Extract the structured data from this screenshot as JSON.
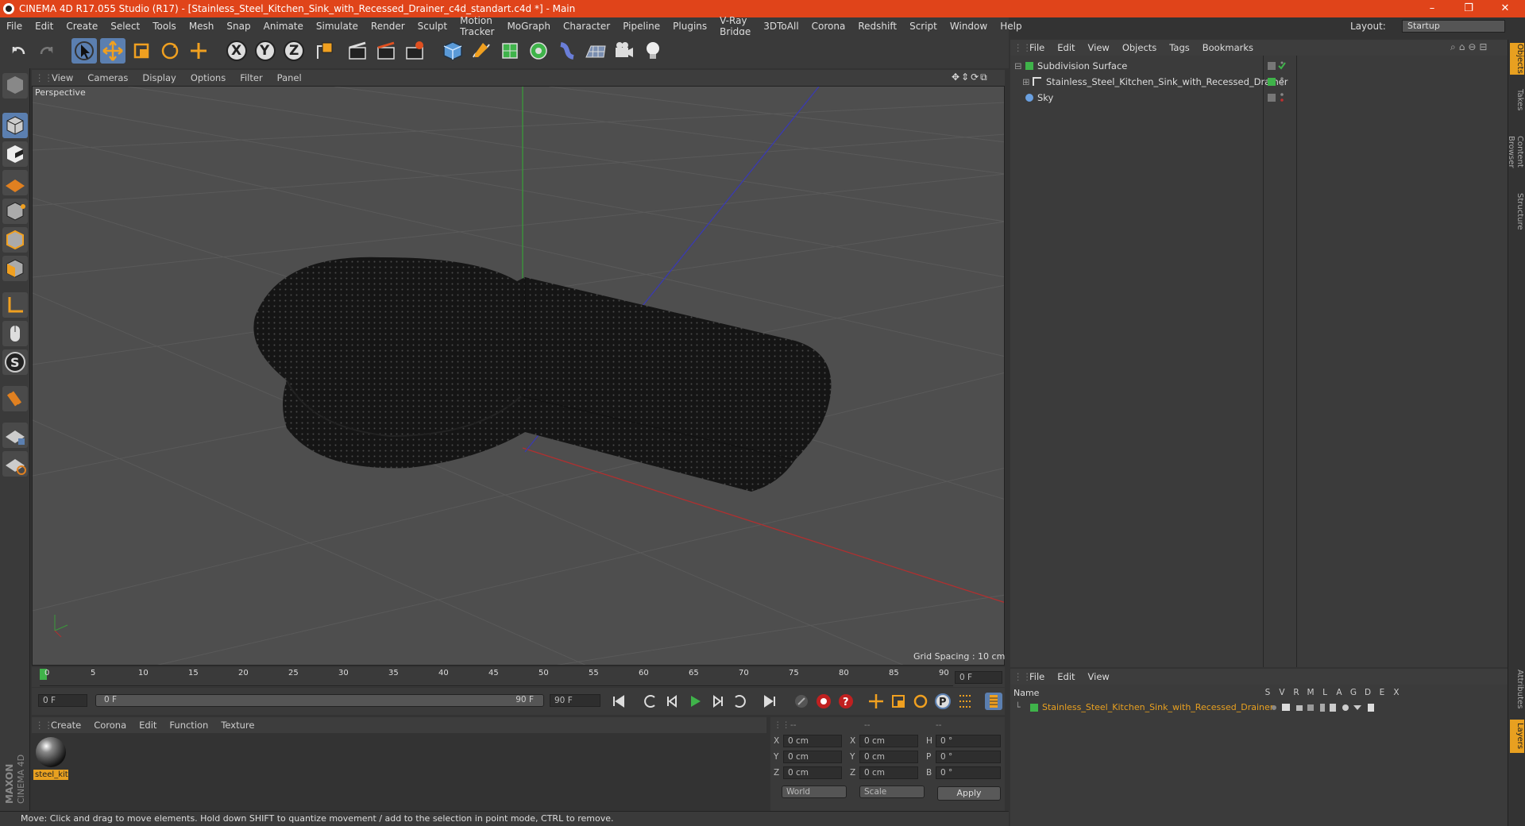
{
  "window": {
    "title": "CINEMA 4D R17.055 Studio (R17) - [Stainless_Steel_Kitchen_Sink_with_Recessed_Drainer_c4d_standart.c4d *] - Main",
    "controls": [
      "–",
      "❐",
      "✕"
    ]
  },
  "menubar": [
    "File",
    "Edit",
    "Create",
    "Select",
    "Tools",
    "Mesh",
    "Snap",
    "Animate",
    "Simulate",
    "Render",
    "Sculpt",
    "Motion Tracker",
    "MoGraph",
    "Character",
    "Pipeline",
    "Plugins",
    "V-Ray Bridge",
    "3DToAll",
    "Corona",
    "Redshift",
    "Script",
    "Window",
    "Help"
  ],
  "layout": {
    "label": "Layout:",
    "value": "Startup"
  },
  "toolbar": {
    "axis_x": "X",
    "axis_y": "Y",
    "axis_z": "Z"
  },
  "viewport": {
    "menu": [
      "View",
      "Cameras",
      "Display",
      "Options",
      "Filter",
      "Panel"
    ],
    "label": "Perspective",
    "grid_spacing": "Grid Spacing : 10 cm"
  },
  "timeline": {
    "ticks": [
      "0",
      "5",
      "10",
      "15",
      "20",
      "25",
      "30",
      "35",
      "40",
      "45",
      "50",
      "55",
      "60",
      "65",
      "70",
      "75",
      "80",
      "85",
      "90"
    ],
    "current_frame": "0 F",
    "start_field": "0 F",
    "range_start": "0 F",
    "range_end": "90 F",
    "end_field": "90 F"
  },
  "material_manager": {
    "menu": [
      "Create",
      "Corona",
      "Edit",
      "Function",
      "Texture"
    ],
    "material_name": "steel_kit"
  },
  "coordinates": {
    "headers": [
      "--",
      "--",
      "--"
    ],
    "rows": [
      {
        "a": "X",
        "av": "0 cm",
        "b": "X",
        "bv": "0 cm",
        "c": "H",
        "cv": "0 °"
      },
      {
        "a": "Y",
        "av": "0 cm",
        "b": "Y",
        "bv": "0 cm",
        "c": "P",
        "cv": "0 °"
      },
      {
        "a": "Z",
        "av": "0 cm",
        "b": "Z",
        "bv": "0 cm",
        "c": "B",
        "cv": "0 °"
      }
    ],
    "mode1": "World",
    "mode2": "Scale",
    "apply": "Apply"
  },
  "status": "Move: Click and drag to move elements. Hold down SHIFT to quantize movement / add to the selection in point mode, CTRL to remove.",
  "object_manager": {
    "menu": [
      "File",
      "Edit",
      "View",
      "Objects",
      "Tags",
      "Bookmarks"
    ],
    "objects": [
      {
        "name": "Subdivision Surface"
      },
      {
        "name": "Stainless_Steel_Kitchen_Sink_with_Recessed_Drainer"
      },
      {
        "name": "Sky"
      }
    ]
  },
  "layer_manager": {
    "menu": [
      "File",
      "Edit",
      "View"
    ],
    "name_header": "Name",
    "columns": [
      "S",
      "V",
      "R",
      "M",
      "L",
      "A",
      "G",
      "D",
      "E",
      "X"
    ],
    "layer_name": "Stainless_Steel_Kitchen_Sink_with_Recessed_Drainer"
  },
  "right_tabs": [
    "Objects",
    "Takes",
    "Content Browser",
    "Structure",
    "Attributes",
    "Layers"
  ],
  "brand": "MAXON CINEMA 4D",
  "colors": {
    "accent": "#e0441a",
    "selection": "#5b7fb0",
    "layer_text": "#e8a020"
  }
}
